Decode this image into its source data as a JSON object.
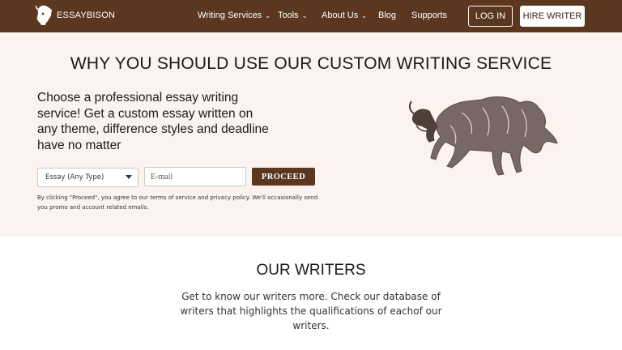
{
  "header": {
    "logo_text": "ESSAYBISON",
    "nav": [
      {
        "label": "Writing Services",
        "has_dropdown": true
      },
      {
        "label": "Tools",
        "has_dropdown": true
      },
      {
        "label": "About Us",
        "has_dropdown": true
      },
      {
        "label": "Blog",
        "has_dropdown": false
      },
      {
        "label": "Supports",
        "has_dropdown": false
      }
    ],
    "login_label": "LOG IN",
    "hire_label": "HIRE WRITER"
  },
  "hero": {
    "title": "WHY YOU SHOULD USE OUR CUSTOM WRITING SERVICE",
    "subtitle": "Choose a professional essay writing service! Get a custom essay written on any theme, difference styles and deadline have no matter",
    "select_value": "Essay (Any Type)",
    "email_placeholder": "E-mail",
    "proceed_label": "PROCEED",
    "terms_text": "By clicking \"Proceed\", you agree to our terms of service and privacy policy. We'll occasionally send you promo and account related emails."
  },
  "writers": {
    "title": "OUR WRITERS",
    "text": "Get to know our writers more. Check our database of writers that highlights the qualifications of eachof our writers."
  },
  "colors": {
    "brand_brown": "#5c3720",
    "hero_bg": "#fcf2ef"
  }
}
